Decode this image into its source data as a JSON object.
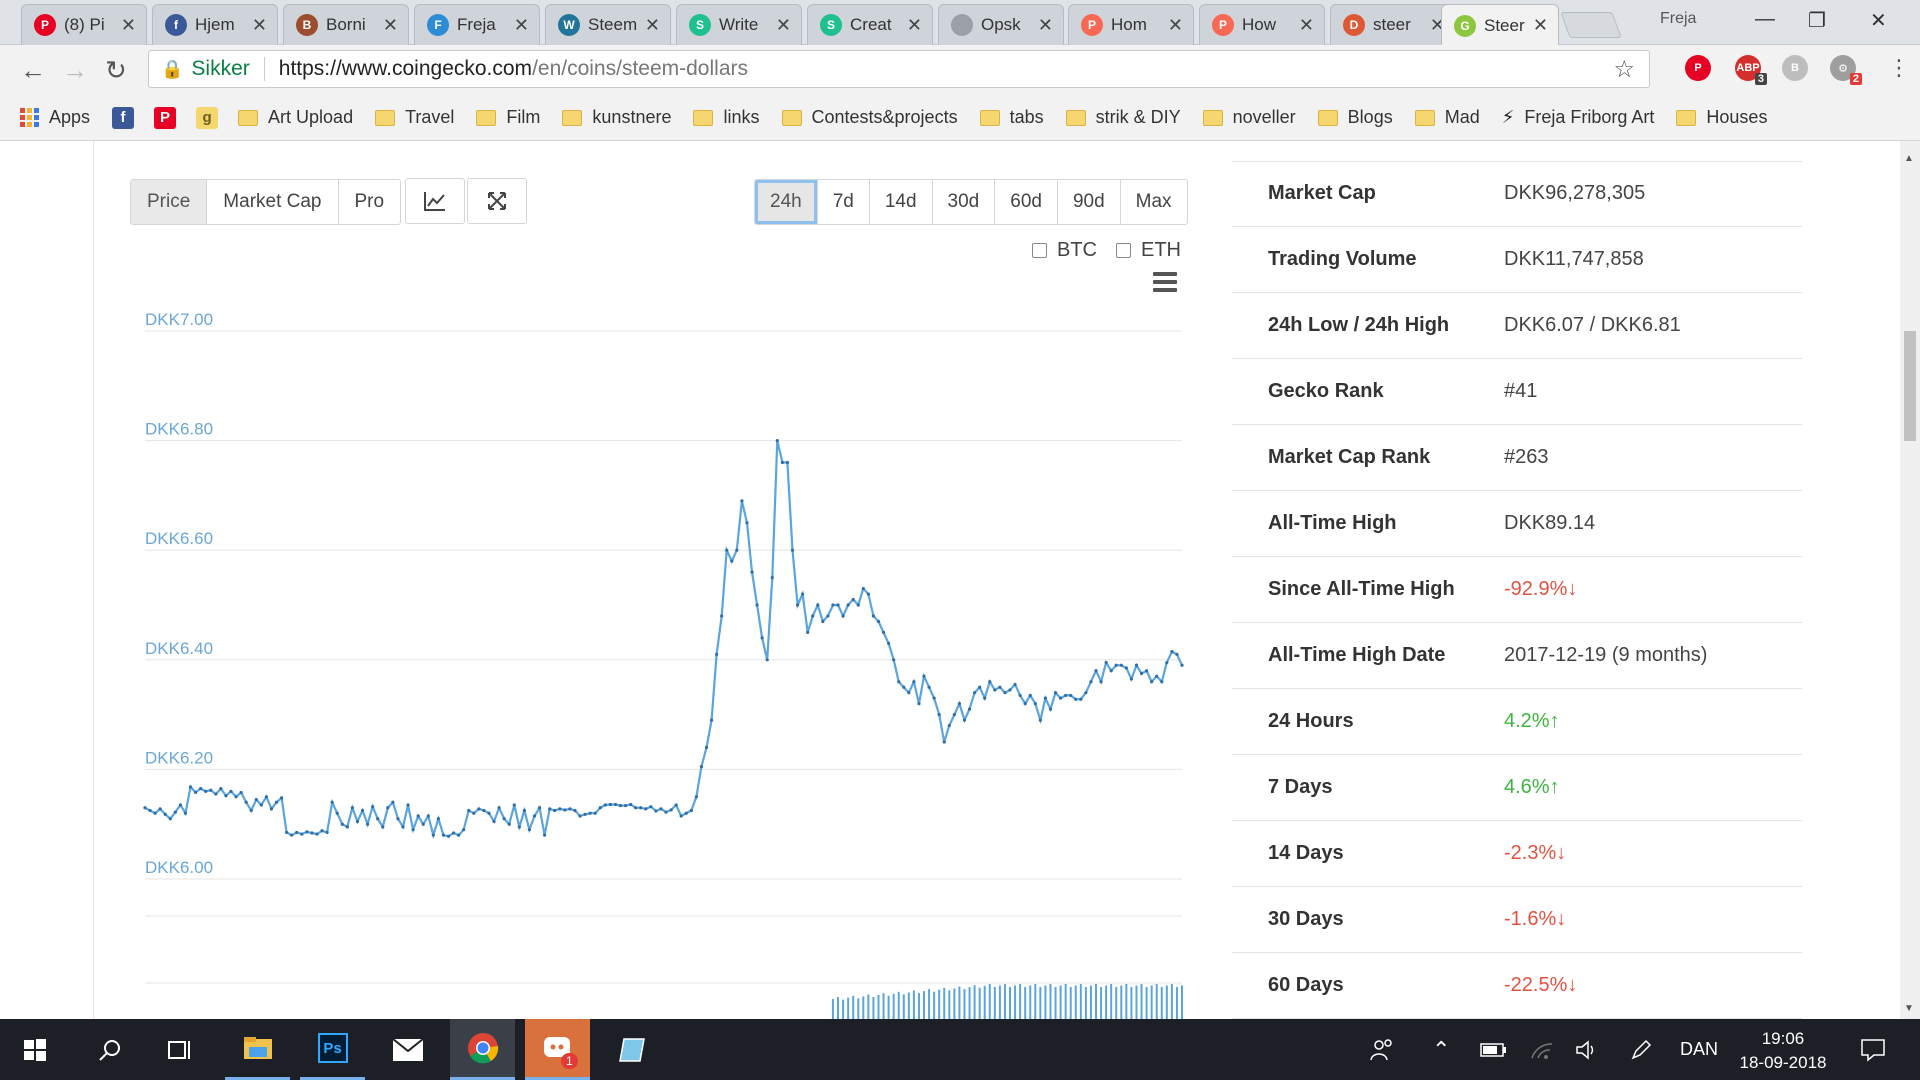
{
  "browser": {
    "tabs": [
      {
        "title": "(8) Pi",
        "icon": "pinterest-icon",
        "color": "#e60023",
        "letter": "P"
      },
      {
        "title": "Hjem",
        "icon": "facebook-icon",
        "color": "#3b5998",
        "letter": "f"
      },
      {
        "title": "Borni",
        "icon": "bear-icon",
        "color": "#9b4d2e",
        "letter": "B"
      },
      {
        "title": "Freja",
        "icon": "swirl-icon",
        "color": "#2d8cd6",
        "letter": "F"
      },
      {
        "title": "Steem",
        "icon": "wordpress-icon",
        "color": "#21759b",
        "letter": "W"
      },
      {
        "title": "Write",
        "icon": "steemit-icon",
        "color": "#1fbf8f",
        "letter": "S"
      },
      {
        "title": "Creat",
        "icon": "steemit-icon",
        "color": "#1fbf8f",
        "letter": "S"
      },
      {
        "title": "Opsk",
        "icon": "document-icon",
        "color": "#9aa0a6",
        "letter": ""
      },
      {
        "title": "Hom",
        "icon": "patreon-icon",
        "color": "#f96854",
        "letter": "P"
      },
      {
        "title": "How",
        "icon": "patreon-icon",
        "color": "#f96854",
        "letter": "P"
      },
      {
        "title": "steer",
        "icon": "duckduckgo-icon",
        "color": "#de5833",
        "letter": "D"
      },
      {
        "title": "Steer",
        "icon": "coingecko-icon",
        "color": "#8dc63f",
        "letter": "G",
        "active": true
      }
    ],
    "profile_name": "Freja",
    "address": {
      "secure_label": "Sikker",
      "url_scheme_host": "https://www.coingecko.com",
      "url_path": "/en/coins/steem-dollars"
    },
    "extensions": [
      {
        "name": "pinterest-extension-icon",
        "color": "#e60023",
        "letter": "P",
        "badge": ""
      },
      {
        "name": "adblock-extension-icon",
        "color": "#d32f2f",
        "letter": "ABP",
        "badge": "3"
      },
      {
        "name": "b-extension-icon",
        "color": "#bdbdbd",
        "letter": "B",
        "badge": ""
      },
      {
        "name": "puzzle-extension-icon",
        "color": "#9e9e9e",
        "letter": "⚙",
        "badge": "2"
      }
    ],
    "bookmarks": [
      {
        "label": "Apps",
        "type": "apps"
      },
      {
        "label": "",
        "type": "icon",
        "color": "#3b5998",
        "letter": "f"
      },
      {
        "label": "",
        "type": "icon",
        "color": "#e60023",
        "letter": "P"
      },
      {
        "label": "",
        "type": "icon",
        "color": "#f5d76e",
        "letter": "g"
      },
      {
        "label": "Art Upload",
        "type": "folder"
      },
      {
        "label": "Travel",
        "type": "folder"
      },
      {
        "label": "Film",
        "type": "folder"
      },
      {
        "label": "kunstnere",
        "type": "folder"
      },
      {
        "label": "links",
        "type": "folder"
      },
      {
        "label": "Contests&projects",
        "type": "folder"
      },
      {
        "label": "tabs",
        "type": "folder"
      },
      {
        "label": "strik & DIY",
        "type": "folder"
      },
      {
        "label": "noveller",
        "type": "folder"
      },
      {
        "label": "Blogs",
        "type": "folder"
      },
      {
        "label": "Mad",
        "type": "folder"
      },
      {
        "label": "Freja Friborg Art",
        "type": "bolt"
      },
      {
        "label": "Houses",
        "type": "folder"
      }
    ]
  },
  "chart_controls": {
    "metric_buttons": [
      "Price",
      "Market Cap",
      "Pro"
    ],
    "selected_metric": "Price",
    "range_buttons": [
      "24h",
      "7d",
      "14d",
      "30d",
      "60d",
      "90d",
      "Max"
    ],
    "selected_range": "24h",
    "compare": [
      "BTC",
      "ETH"
    ]
  },
  "chart_data": {
    "type": "line",
    "y_tick_labels": [
      "DKK7.00",
      "DKK6.80",
      "DKK6.60",
      "DKK6.40",
      "DKK6.20",
      "DKK6.00"
    ],
    "ylim": [
      6.0,
      7.0
    ],
    "grid": true,
    "color": "#5ca4dc",
    "series": [
      {
        "values": [
          6.13,
          6.125,
          6.12,
          6.128,
          6.118,
          6.11,
          6.122,
          6.135,
          6.12,
          6.168,
          6.158,
          6.165,
          6.16,
          6.162,
          6.155,
          6.165,
          6.152,
          6.16,
          6.15,
          6.158,
          6.14,
          6.125,
          6.145,
          6.135,
          6.15,
          6.128,
          6.14,
          6.148,
          6.085,
          6.08,
          6.085,
          6.082,
          6.086,
          6.084,
          6.082,
          6.088,
          6.085,
          6.14,
          6.12,
          6.1,
          6.095,
          6.13,
          6.105,
          6.125,
          6.1,
          6.132,
          6.11,
          6.095,
          6.13,
          6.14,
          6.11,
          6.095,
          6.135,
          6.09,
          6.115,
          6.1,
          6.115,
          6.08,
          6.11,
          6.08,
          6.078,
          6.084,
          6.08,
          6.09,
          6.125,
          6.12,
          6.128,
          6.125,
          6.12,
          6.105,
          6.13,
          6.11,
          6.1,
          6.135,
          6.095,
          6.125,
          6.09,
          6.115,
          6.13,
          6.08,
          6.128,
          6.125,
          6.128,
          6.126,
          6.128,
          6.125,
          6.115,
          6.118,
          6.12,
          6.12,
          6.13,
          6.135,
          6.136,
          6.136,
          6.134,
          6.134,
          6.136,
          6.13,
          6.13,
          6.128,
          6.132,
          6.124,
          6.128,
          6.122,
          6.126,
          6.135,
          6.115,
          6.12,
          6.125,
          6.15,
          6.205,
          6.24,
          6.29,
          6.41,
          6.48,
          6.6,
          6.58,
          6.6,
          6.69,
          6.65,
          6.56,
          6.5,
          6.44,
          6.4,
          6.55,
          6.8,
          6.76,
          6.76,
          6.6,
          6.5,
          6.52,
          6.45,
          6.48,
          6.5,
          6.47,
          6.48,
          6.5,
          6.5,
          6.48,
          6.5,
          6.51,
          6.5,
          6.53,
          6.52,
          6.48,
          6.47,
          6.45,
          6.43,
          6.4,
          6.36,
          6.35,
          6.34,
          6.36,
          6.32,
          6.37,
          6.35,
          6.33,
          6.3,
          6.25,
          6.28,
          6.3,
          6.32,
          6.29,
          6.31,
          6.34,
          6.35,
          6.33,
          6.36,
          6.345,
          6.35,
          6.34,
          6.345,
          6.355,
          6.335,
          6.32,
          6.335,
          6.32,
          6.29,
          6.33,
          6.31,
          6.34,
          6.33,
          6.335,
          6.335,
          6.328,
          6.328,
          6.34,
          6.36,
          6.38,
          6.36,
          6.395,
          6.38,
          6.39,
          6.39,
          6.385,
          6.365,
          6.39,
          6.375,
          6.38,
          6.36,
          6.37,
          6.36,
          6.395,
          6.415,
          6.41,
          6.39
        ]
      }
    ]
  },
  "stats": [
    {
      "label": "Market Cap",
      "value": "DKK96,278,305",
      "trend": ""
    },
    {
      "label": "Trading Volume",
      "value": "DKK11,747,858",
      "trend": ""
    },
    {
      "label": "24h Low / 24h High",
      "value": "DKK6.07 / DKK6.81",
      "trend": ""
    },
    {
      "label": "Gecko Rank",
      "value": "#41",
      "trend": ""
    },
    {
      "label": "Market Cap Rank",
      "value": "#263",
      "trend": ""
    },
    {
      "label": "All-Time High",
      "value": "DKK89.14",
      "trend": ""
    },
    {
      "label": "Since All-Time High",
      "value": "-92.9%",
      "trend": "down"
    },
    {
      "label": "All-Time High Date",
      "value": "2017-12-19 (9 months)",
      "trend": ""
    },
    {
      "label": "24 Hours",
      "value": "4.2%",
      "trend": "up"
    },
    {
      "label": "7 Days",
      "value": "4.6%",
      "trend": "up"
    },
    {
      "label": "14 Days",
      "value": "-2.3%",
      "trend": "down"
    },
    {
      "label": "30 Days",
      "value": "-1.6%",
      "trend": "down"
    },
    {
      "label": "60 Days",
      "value": "-22.5%",
      "trend": "down"
    }
  ],
  "taskbar": {
    "language": "DAN",
    "time": "19:06",
    "date": "18-09-2018",
    "discord_badge": "1"
  }
}
